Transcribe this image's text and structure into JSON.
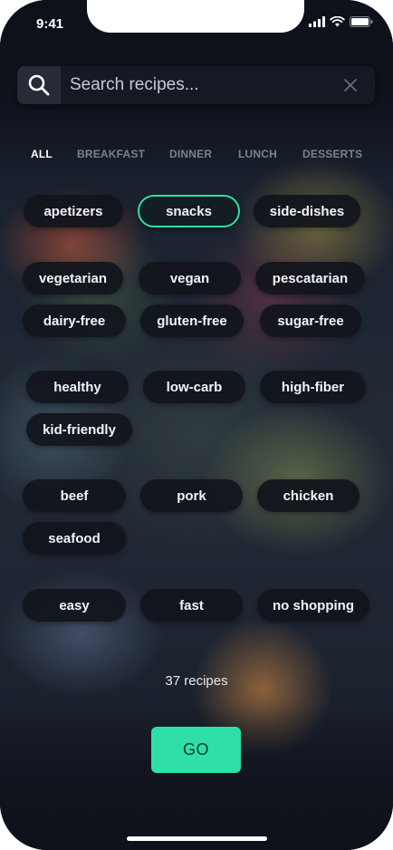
{
  "status_bar": {
    "time": "9:41"
  },
  "search": {
    "placeholder": "Search recipes...",
    "value": ""
  },
  "tabs": [
    {
      "label": "ALL",
      "active": true
    },
    {
      "label": "BREAKFAST",
      "active": false
    },
    {
      "label": "DINNER",
      "active": false
    },
    {
      "label": "LUNCH",
      "active": false
    },
    {
      "label": "DESSERTS",
      "active": false
    }
  ],
  "filters": {
    "course": [
      "apetizers",
      "snacks",
      "side-dishes"
    ],
    "diet": [
      "vegetarian",
      "vegan",
      "pescatarian",
      "dairy-free",
      "gluten-free",
      "sugar-free"
    ],
    "health": [
      "healthy",
      "low-carb",
      "high-fiber",
      "kid-friendly"
    ],
    "protein": [
      "beef",
      "pork",
      "chicken",
      "seafood"
    ],
    "effort": [
      "easy",
      "fast",
      "no shopping"
    ],
    "selected": [
      "snacks"
    ]
  },
  "result_count": "37 recipes",
  "go_label": "GO",
  "colors": {
    "accent": "#2ee0a8",
    "chip_bg": "#11141c",
    "search_bg": "#151923"
  }
}
